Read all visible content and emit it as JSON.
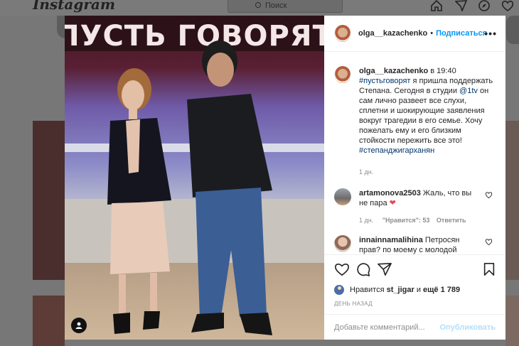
{
  "topbar": {
    "logo": "Instagram",
    "search_placeholder": "Поиск"
  },
  "post": {
    "username": "olga__kazachenko",
    "follow_label": "Подписаться",
    "caption": {
      "username": "olga__kazachenko",
      "time": "в 19:40",
      "hashtag1": "#пустьговорят",
      "text1": "я пришла поддержать Степана. Сегодня в студии",
      "mention": "@1tv",
      "text2": "он сам лично развеет все слухи, сплетни и шокирующие заявления вокруг трагедии в его семье. Хочу пожелать ему и его близким стойкости пережить все это!",
      "hashtag2": "#степанджигарханян",
      "age": "1 дн."
    },
    "comments": [
      {
        "username": "artamonova2503",
        "text": "Жаль, что вы не пара",
        "emoji": "❤",
        "age": "1 дн.",
        "likes": "\"Нравится\": 53",
        "reply": "Ответить"
      },
      {
        "username": "innainnamalihina",
        "text": "Петросян прав? по моему с молодой женой Артист бы дольше"
      }
    ],
    "likes": {
      "prefix": "Нравится",
      "user": "st_jigar",
      "conj": "и",
      "rest": "ещё 1 789"
    },
    "time_ago": "ДЕНЬ НАЗАД",
    "comment_placeholder": "Добавьте комментарий...",
    "publish_label": "Опубликовать",
    "photo_sign": "ПУСТЬ ГОВОРЯТ"
  }
}
